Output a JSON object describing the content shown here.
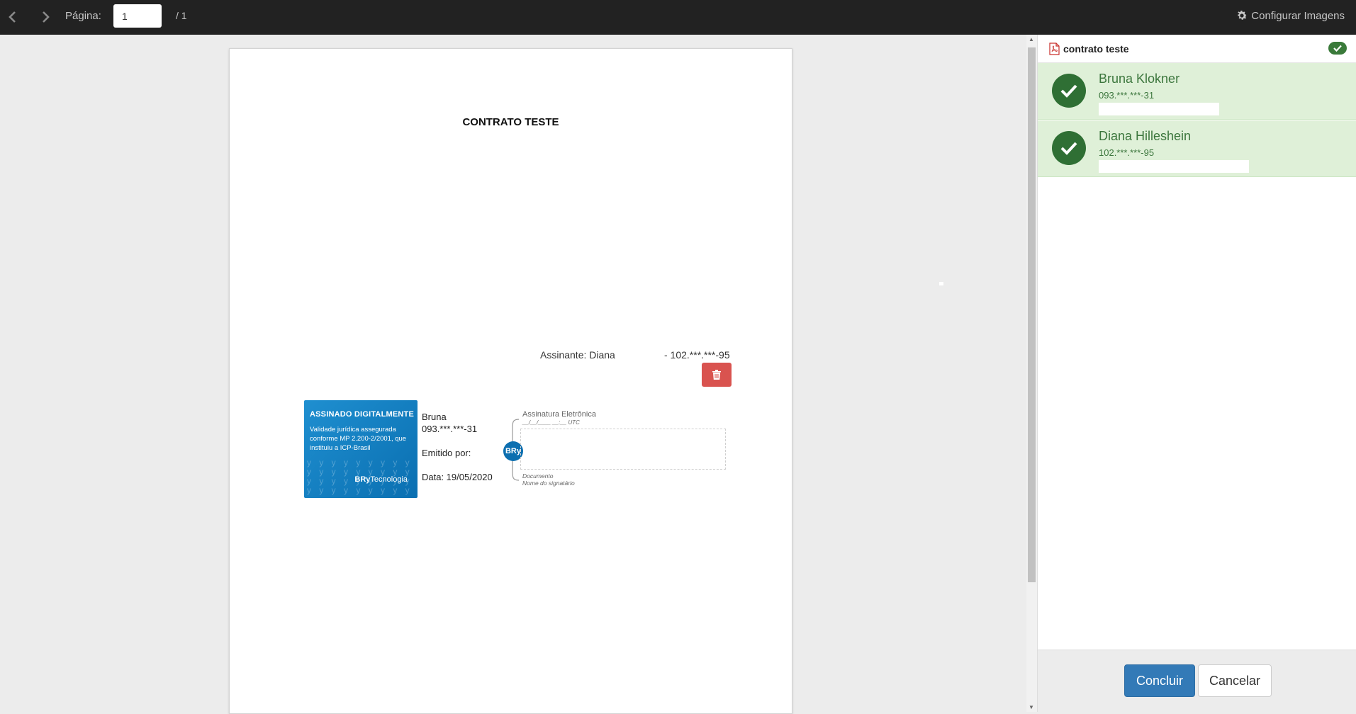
{
  "toolbar": {
    "page_label": "Página:",
    "page_value": "1",
    "page_total": "/ 1",
    "config_label": "Configurar Imagens"
  },
  "document": {
    "title": "CONTRATO TESTE",
    "signer_label": "Assinante: Diana",
    "signer_cpf": "- 102.***.***-95",
    "stamp": {
      "title": "ASSINADO DIGITALMENTE",
      "text": "Validade jurídica assegurada conforme MP 2.200-2/2001, que instituiu a ICP-Brasil",
      "pattern": "y y y y y y y y y",
      "brand_bold": "BRy",
      "brand_rest": "Tecnologia",
      "color": "#0a6fb1"
    },
    "stamp_info": {
      "name": "Bruna",
      "cpf": "093.***.***-31",
      "emitted": "Emitido por:",
      "date": "Data: 19/05/2020"
    },
    "esig": {
      "badge": "BRy",
      "head": "Assinatura Eletrônica",
      "date_placeholder": "__/__/____ __:__ UTC",
      "doc_line1": "Documento",
      "doc_line2": "Nome do signatário"
    }
  },
  "panel": {
    "title": "contrato teste",
    "signers": [
      {
        "name": "Bruna Klokner",
        "doc": "093.***.***-31"
      },
      {
        "name": "Diana Hilleshein",
        "doc": "102.***.***-95"
      }
    ],
    "accent": "#3c763d",
    "row_bg": "#dff0d8"
  },
  "footer": {
    "confirm_label": "Concluir",
    "cancel_label": "Cancelar"
  }
}
